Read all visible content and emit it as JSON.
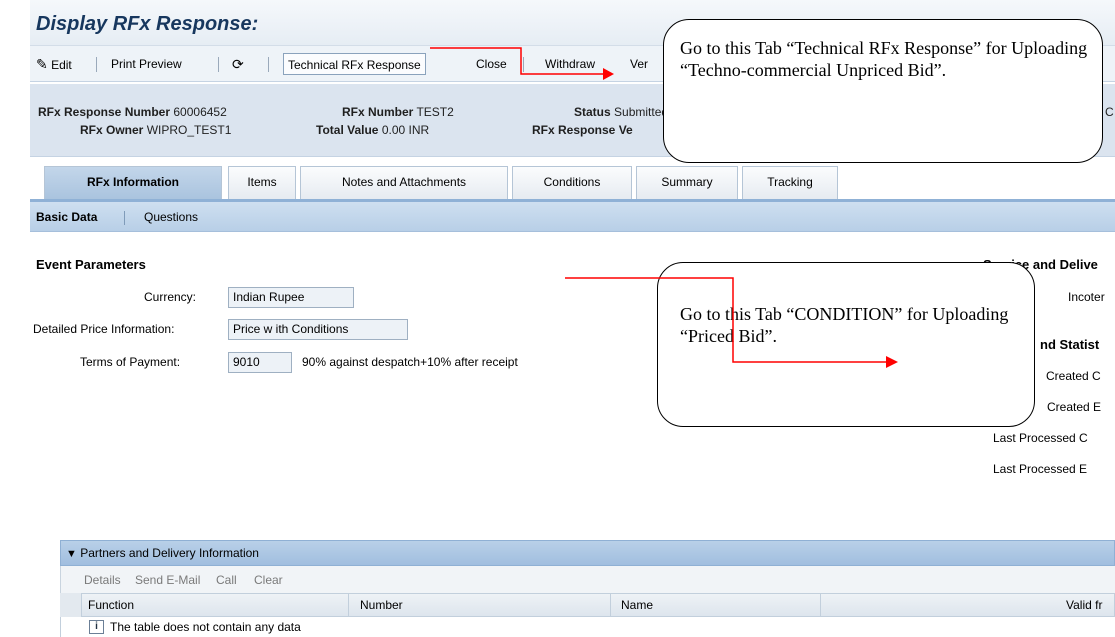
{
  "title": "Display RFx Response:",
  "toolbar": {
    "edit": "Edit",
    "print_preview": "Print Preview",
    "tech_rfx_response": "Technical RFx Response",
    "close": "Close",
    "withdraw": "Withdraw",
    "version_partial": "Ver"
  },
  "header": {
    "rfx_response_number_label": "RFx Response Number",
    "rfx_response_number": "60006452",
    "rfx_owner_label": "RFx Owner",
    "rfx_owner": "WIPRO_TEST1",
    "rfx_number_label": "RFx Number",
    "rfx_number": "TEST2",
    "total_value_label": "Total Value",
    "total_value": "0.00 INR",
    "status_label": "Status",
    "status": "Submitted",
    "rfx_response_version_label": "RFx Response Ve",
    "right_partial": "C"
  },
  "tabs": [
    {
      "label": "RFx Information",
      "active": true
    },
    {
      "label": "Items"
    },
    {
      "label": "Notes and Attachments"
    },
    {
      "label": "Conditions"
    },
    {
      "label": "Summary"
    },
    {
      "label": "Tracking"
    }
  ],
  "subnav": {
    "basic_data": "Basic Data",
    "questions": "Questions"
  },
  "event_parameters": {
    "heading": "Event Parameters",
    "currency_label": "Currency:",
    "currency": "Indian Rupee",
    "price_info_label": "Detailed Price Information:",
    "price_info": "Price w ith Conditions",
    "terms_label": "Terms of Payment:",
    "terms_code": "9010",
    "terms_desc": "90% against despatch+10% after receipt"
  },
  "right_panel": {
    "service_delivery": "Service and Delive",
    "incoterms": "Incoter",
    "statistics": "nd Statist",
    "created_on": "Created C",
    "created_by": "Created E",
    "last_processed_on": "Last Processed C",
    "last_processed_by": "Last Processed E"
  },
  "callouts": {
    "tech": "Go to this Tab “Technical RFx Response” for Uploading “Techno-commercial Unpriced Bid”.",
    "condition": "Go to this Tab “CONDITION” for Uploading “Priced Bid”."
  },
  "partners": {
    "heading": "Partners and Delivery Information",
    "tools": [
      "Details",
      "Send E-Mail",
      "Call",
      "Clear"
    ],
    "columns": [
      "Function",
      "Number",
      "Name",
      "Valid fr"
    ],
    "empty_message": "The table does not contain any data"
  },
  "colors": {
    "arrow": "#ff0000",
    "title": "#17375e",
    "header_bg": "#dbe4ef"
  }
}
